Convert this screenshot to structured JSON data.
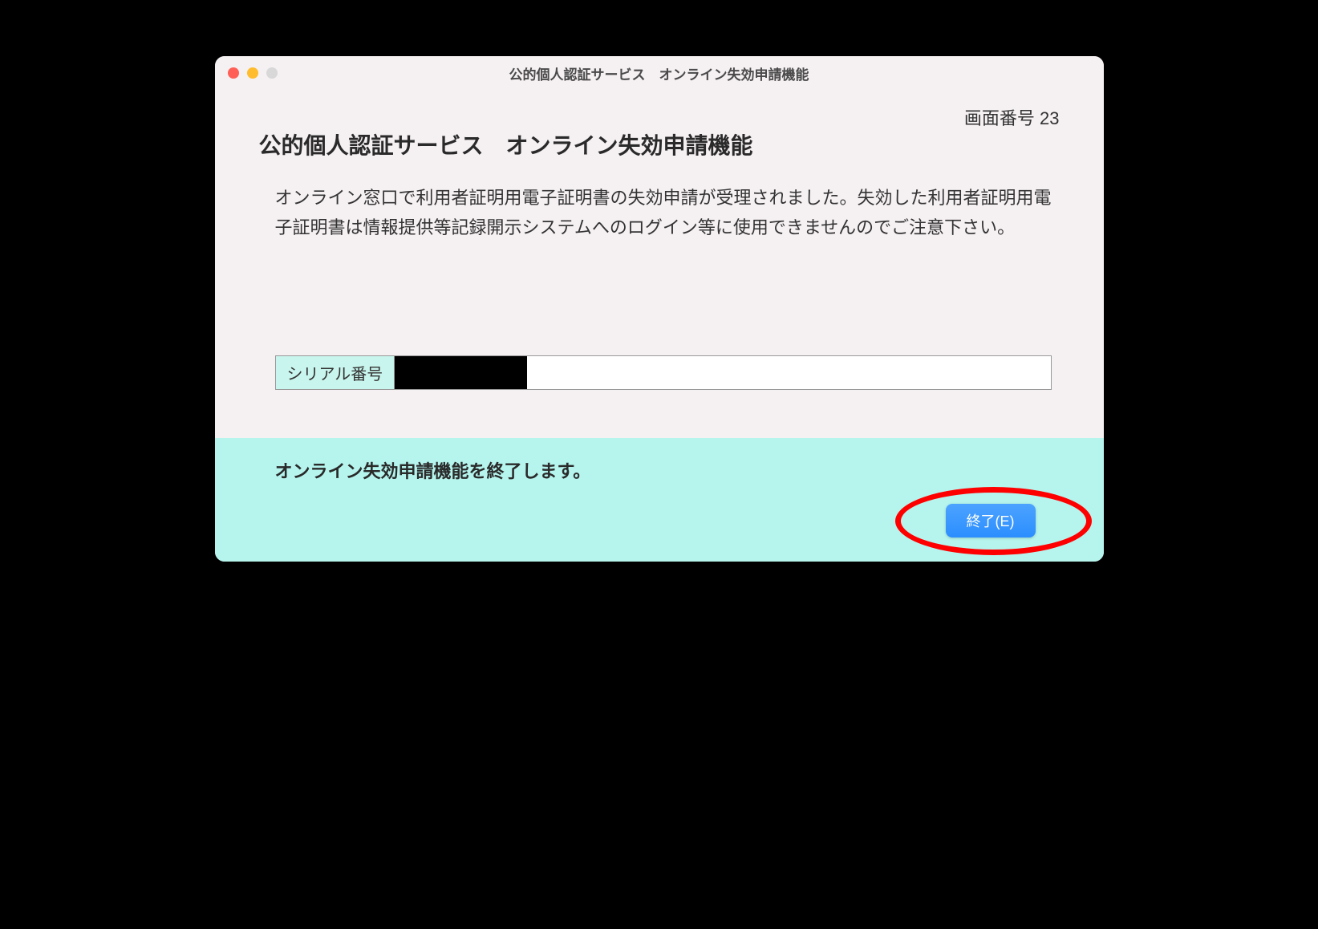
{
  "window": {
    "title": "公的個人認証サービス　オンライン失効申請機能"
  },
  "header": {
    "screen_number": "画面番号 23",
    "heading": "公的個人認証サービス　オンライン失効申請機能"
  },
  "main": {
    "message": "オンライン窓口で利用者証明用電子証明書の失効申請が受理されました。失効した利用者証明用電子証明書は情報提供等記録開示システムへのログイン等に使用できませんのでご注意下さい。",
    "serial_label": "シリアル番号"
  },
  "footer": {
    "message": "オンライン失効申請機能を終了します。",
    "exit_button": "終了(E)"
  }
}
